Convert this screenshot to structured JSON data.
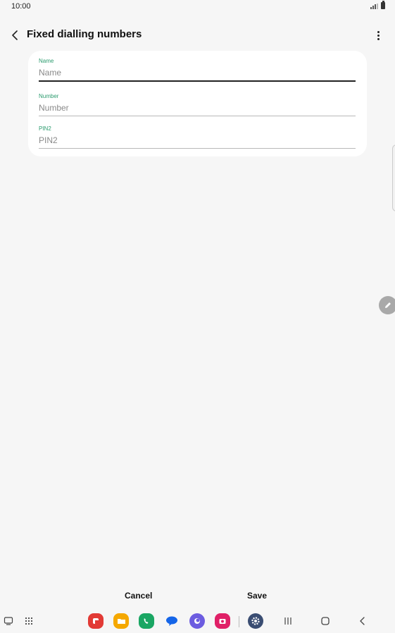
{
  "status_bar": {
    "time": "10:00"
  },
  "header": {
    "title": "Fixed dialling numbers"
  },
  "form": {
    "fields": [
      {
        "label": "Name",
        "placeholder": "Name",
        "value": ""
      },
      {
        "label": "Number",
        "placeholder": "Number",
        "value": ""
      },
      {
        "label": "PIN2",
        "placeholder": "PIN2",
        "value": ""
      }
    ]
  },
  "actions": {
    "cancel_label": "Cancel",
    "save_label": "Save"
  },
  "colors": {
    "accent_green": "#2b9b6e",
    "background": "#f6f6f6",
    "card": "#ffffff"
  },
  "taskbar": {
    "icons": [
      "recent-apps-icon",
      "app-drawer-icon",
      "flipboard-app-icon",
      "files-app-icon",
      "phone-app-icon",
      "messages-app-icon",
      "internet-app-icon",
      "camera-app-icon",
      "settings-app-icon",
      "recents-nav-icon",
      "home-nav-icon",
      "back-nav-icon"
    ]
  }
}
